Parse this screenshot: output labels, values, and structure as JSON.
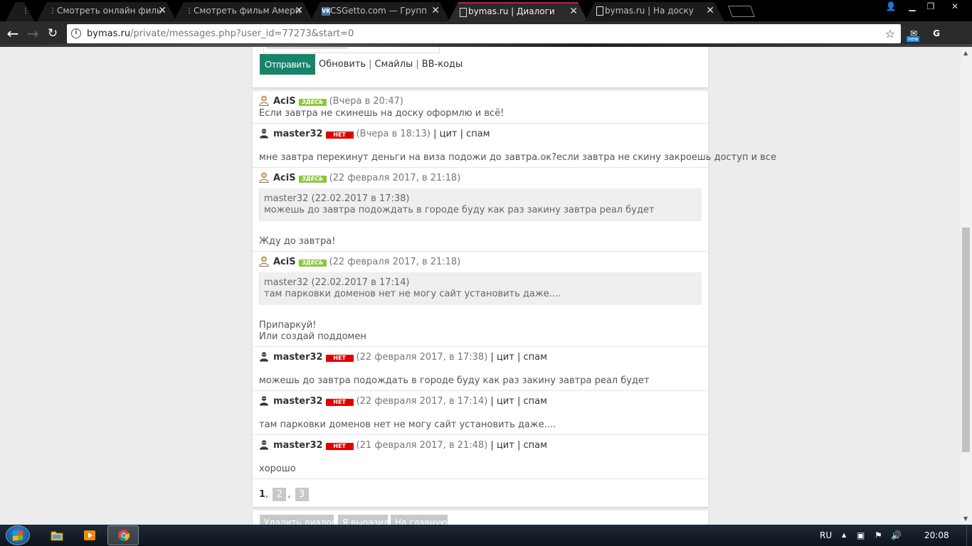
{
  "browser": {
    "tabs": [
      {
        "title": "Смотреть онлайн филь",
        "favicon": "film-icon",
        "active": false
      },
      {
        "title": "Смотреть фильм Амери",
        "favicon": "film-icon",
        "active": false
      },
      {
        "title": "CSGetto.com — Групп",
        "favicon": "vk-icon",
        "active": false
      },
      {
        "title": "bymas.ru | Диалоги",
        "favicon": "page-icon",
        "active": true
      },
      {
        "title": "bymas.ru | На доску",
        "favicon": "page-icon",
        "active": false
      }
    ],
    "url_host": "bymas.ru",
    "url_path": "/private/messages.php?user_id=77273&start=0",
    "ext_badge": "new",
    "ext_letter": "G"
  },
  "form": {
    "send_label": "Отправить",
    "links": [
      "Обновить",
      "Смайлы",
      "BB-коды"
    ]
  },
  "messages": [
    {
      "nick": "AciS",
      "status": "ЗДЕСЬ",
      "online": true,
      "time": "(Вчера в 20:47)",
      "actions": [],
      "quote": null,
      "body": [
        "Если завтра не скинешь на доску оформлю и всё!"
      ]
    },
    {
      "nick": "master32",
      "status": "НЕТ",
      "online": false,
      "time": "(Вчера в 18:13)",
      "actions": [
        "цит",
        "спам"
      ],
      "quote": null,
      "body": [
        "мне завтра перекинут деньги на виза подожи до завтра.ок?если завтра не скину закроешь доступ и все"
      ]
    },
    {
      "nick": "AciS",
      "status": "ЗДЕСЬ",
      "online": true,
      "time": "(22 февраля 2017, в 21:18)",
      "actions": [],
      "quote": {
        "author": "master32 (22.02.2017 в 17:38)",
        "text": "можешь до завтра подождать в городе буду как раз закину завтра реал будет"
      },
      "body": [
        "Жду до завтра!"
      ]
    },
    {
      "nick": "AciS",
      "status": "ЗДЕСЬ",
      "online": true,
      "time": "(22 февраля 2017, в 21:18)",
      "actions": [],
      "quote": {
        "author": "master32 (22.02.2017 в 17:14)",
        "text": "там парковки доменов нет не могу сайт установить даже...."
      },
      "body": [
        "Припаркуй!",
        "Или создай поддомен"
      ]
    },
    {
      "nick": "master32",
      "status": "НЕТ",
      "online": false,
      "time": "(22 февраля 2017, в 17:38)",
      "actions": [
        "цит",
        "спам"
      ],
      "quote": null,
      "body": [
        "можешь до завтра подождать в городе буду как раз закину завтра реал будет"
      ]
    },
    {
      "nick": "master32",
      "status": "НЕТ",
      "online": false,
      "time": "(22 февраля 2017, в 17:14)",
      "actions": [
        "цит",
        "спам"
      ],
      "quote": null,
      "body": [
        "там парковки доменов нет не могу сайт установить даже...."
      ]
    },
    {
      "nick": "master32",
      "status": "НЕТ",
      "online": false,
      "time": "(21 февраля 2017, в 21:48)",
      "actions": [
        "цит",
        "спам"
      ],
      "quote": null,
      "body": [
        "хорошо"
      ]
    }
  ],
  "pager": {
    "current": "1",
    "pages": [
      "2",
      "3"
    ]
  },
  "bottom_buttons": [
    "Удалить диалог",
    "Я выразил",
    "На главную"
  ],
  "taskbar": {
    "lang": "RU",
    "clock": "20:08"
  },
  "colors": {
    "accent": "#15846b",
    "online": "#8cc63e",
    "offline": "#e00000",
    "tab_indicator": "#c2185b"
  }
}
